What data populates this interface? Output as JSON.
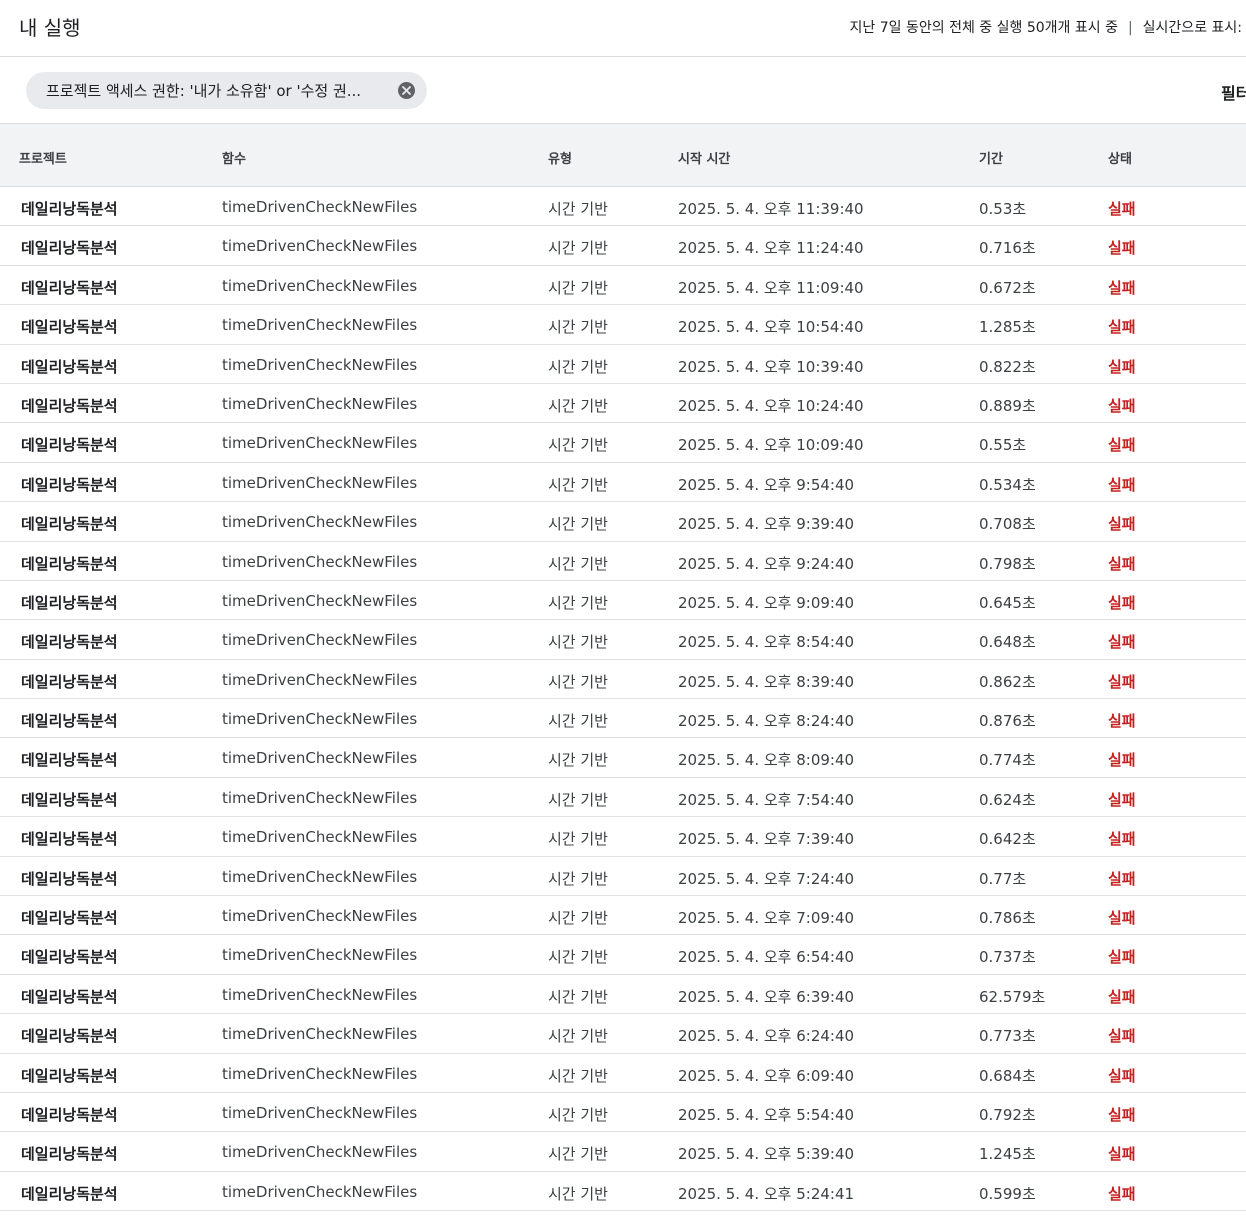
{
  "header": {
    "title": "내 실행",
    "summary": "지난 7일 동안의 전체 중 실행 50개개 표시 중",
    "separator": "|",
    "realtime_label": "실시간으로 표시:"
  },
  "filter": {
    "chip_label": "프로젝트 액세스 권한: '내가 소유함' or '수정 권...",
    "chip_close_icon": "close-circle-icon",
    "filter_link": "필터"
  },
  "table": {
    "columns": {
      "project": "프로젝트",
      "function": "함수",
      "type": "유형",
      "start_time": "시작 시간",
      "duration": "기간",
      "status": "상태"
    },
    "status_color": "#c5221f",
    "rows": [
      {
        "project": "데일리낭독분석",
        "function": "timeDrivenCheckNewFiles",
        "type": "시간 기반",
        "start_time": "2025. 5. 4. 오후 11:39:40",
        "duration": "0.53초",
        "status": "실패"
      },
      {
        "project": "데일리낭독분석",
        "function": "timeDrivenCheckNewFiles",
        "type": "시간 기반",
        "start_time": "2025. 5. 4. 오후 11:24:40",
        "duration": "0.716초",
        "status": "실패"
      },
      {
        "project": "데일리낭독분석",
        "function": "timeDrivenCheckNewFiles",
        "type": "시간 기반",
        "start_time": "2025. 5. 4. 오후 11:09:40",
        "duration": "0.672초",
        "status": "실패"
      },
      {
        "project": "데일리낭독분석",
        "function": "timeDrivenCheckNewFiles",
        "type": "시간 기반",
        "start_time": "2025. 5. 4. 오후 10:54:40",
        "duration": "1.285초",
        "status": "실패"
      },
      {
        "project": "데일리낭독분석",
        "function": "timeDrivenCheckNewFiles",
        "type": "시간 기반",
        "start_time": "2025. 5. 4. 오후 10:39:40",
        "duration": "0.822초",
        "status": "실패"
      },
      {
        "project": "데일리낭독분석",
        "function": "timeDrivenCheckNewFiles",
        "type": "시간 기반",
        "start_time": "2025. 5. 4. 오후 10:24:40",
        "duration": "0.889초",
        "status": "실패"
      },
      {
        "project": "데일리낭독분석",
        "function": "timeDrivenCheckNewFiles",
        "type": "시간 기반",
        "start_time": "2025. 5. 4. 오후 10:09:40",
        "duration": "0.55초",
        "status": "실패"
      },
      {
        "project": "데일리낭독분석",
        "function": "timeDrivenCheckNewFiles",
        "type": "시간 기반",
        "start_time": "2025. 5. 4. 오후 9:54:40",
        "duration": "0.534초",
        "status": "실패"
      },
      {
        "project": "데일리낭독분석",
        "function": "timeDrivenCheckNewFiles",
        "type": "시간 기반",
        "start_time": "2025. 5. 4. 오후 9:39:40",
        "duration": "0.708초",
        "status": "실패"
      },
      {
        "project": "데일리낭독분석",
        "function": "timeDrivenCheckNewFiles",
        "type": "시간 기반",
        "start_time": "2025. 5. 4. 오후 9:24:40",
        "duration": "0.798초",
        "status": "실패"
      },
      {
        "project": "데일리낭독분석",
        "function": "timeDrivenCheckNewFiles",
        "type": "시간 기반",
        "start_time": "2025. 5. 4. 오후 9:09:40",
        "duration": "0.645초",
        "status": "실패"
      },
      {
        "project": "데일리낭독분석",
        "function": "timeDrivenCheckNewFiles",
        "type": "시간 기반",
        "start_time": "2025. 5. 4. 오후 8:54:40",
        "duration": "0.648초",
        "status": "실패"
      },
      {
        "project": "데일리낭독분석",
        "function": "timeDrivenCheckNewFiles",
        "type": "시간 기반",
        "start_time": "2025. 5. 4. 오후 8:39:40",
        "duration": "0.862초",
        "status": "실패"
      },
      {
        "project": "데일리낭독분석",
        "function": "timeDrivenCheckNewFiles",
        "type": "시간 기반",
        "start_time": "2025. 5. 4. 오후 8:24:40",
        "duration": "0.876초",
        "status": "실패"
      },
      {
        "project": "데일리낭독분석",
        "function": "timeDrivenCheckNewFiles",
        "type": "시간 기반",
        "start_time": "2025. 5. 4. 오후 8:09:40",
        "duration": "0.774초",
        "status": "실패"
      },
      {
        "project": "데일리낭독분석",
        "function": "timeDrivenCheckNewFiles",
        "type": "시간 기반",
        "start_time": "2025. 5. 4. 오후 7:54:40",
        "duration": "0.624초",
        "status": "실패"
      },
      {
        "project": "데일리낭독분석",
        "function": "timeDrivenCheckNewFiles",
        "type": "시간 기반",
        "start_time": "2025. 5. 4. 오후 7:39:40",
        "duration": "0.642초",
        "status": "실패"
      },
      {
        "project": "데일리낭독분석",
        "function": "timeDrivenCheckNewFiles",
        "type": "시간 기반",
        "start_time": "2025. 5. 4. 오후 7:24:40",
        "duration": "0.77초",
        "status": "실패"
      },
      {
        "project": "데일리낭독분석",
        "function": "timeDrivenCheckNewFiles",
        "type": "시간 기반",
        "start_time": "2025. 5. 4. 오후 7:09:40",
        "duration": "0.786초",
        "status": "실패"
      },
      {
        "project": "데일리낭독분석",
        "function": "timeDrivenCheckNewFiles",
        "type": "시간 기반",
        "start_time": "2025. 5. 4. 오후 6:54:40",
        "duration": "0.737초",
        "status": "실패"
      },
      {
        "project": "데일리낭독분석",
        "function": "timeDrivenCheckNewFiles",
        "type": "시간 기반",
        "start_time": "2025. 5. 4. 오후 6:39:40",
        "duration": "62.579초",
        "status": "실패"
      },
      {
        "project": "데일리낭독분석",
        "function": "timeDrivenCheckNewFiles",
        "type": "시간 기반",
        "start_time": "2025. 5. 4. 오후 6:24:40",
        "duration": "0.773초",
        "status": "실패"
      },
      {
        "project": "데일리낭독분석",
        "function": "timeDrivenCheckNewFiles",
        "type": "시간 기반",
        "start_time": "2025. 5. 4. 오후 6:09:40",
        "duration": "0.684초",
        "status": "실패"
      },
      {
        "project": "데일리낭독분석",
        "function": "timeDrivenCheckNewFiles",
        "type": "시간 기반",
        "start_time": "2025. 5. 4. 오후 5:54:40",
        "duration": "0.792초",
        "status": "실패"
      },
      {
        "project": "데일리낭독분석",
        "function": "timeDrivenCheckNewFiles",
        "type": "시간 기반",
        "start_time": "2025. 5. 4. 오후 5:39:40",
        "duration": "1.245초",
        "status": "실패"
      },
      {
        "project": "데일리낭독분석",
        "function": "timeDrivenCheckNewFiles",
        "type": "시간 기반",
        "start_time": "2025. 5. 4. 오후 5:24:41",
        "duration": "0.599초",
        "status": "실패"
      }
    ]
  }
}
